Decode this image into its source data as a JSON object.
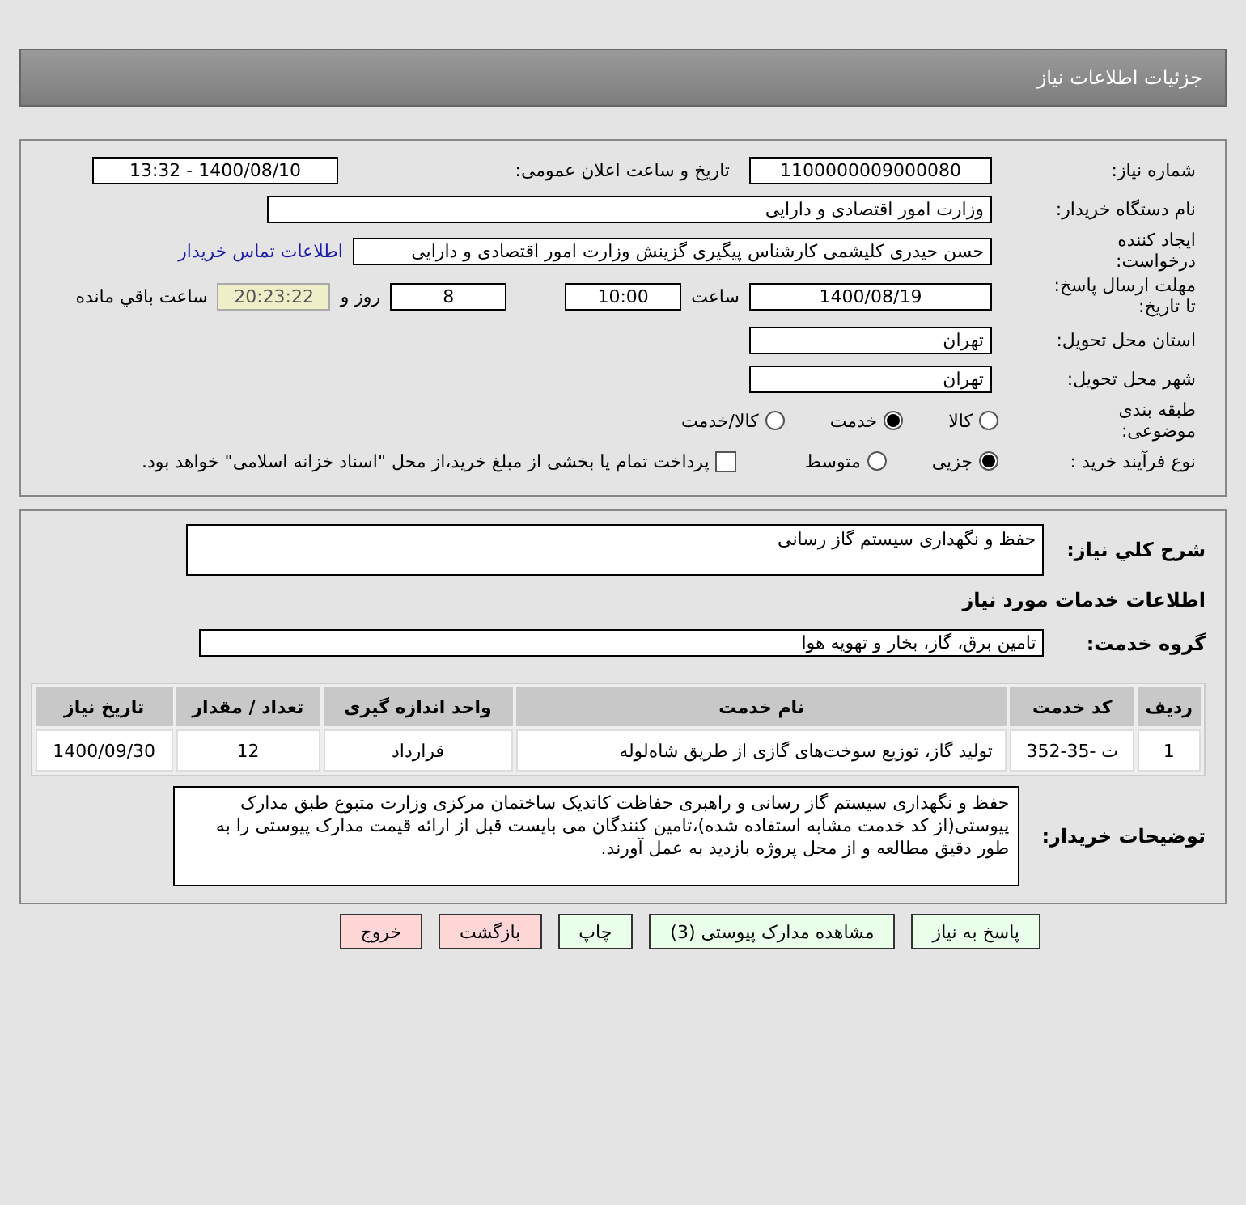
{
  "header": {
    "title": "جزئیات اطلاعات نیاز"
  },
  "details": {
    "need_number": {
      "label": "شماره نیاز:",
      "value": "1100000009000080"
    },
    "announce": {
      "label": "تاریخ و ساعت اعلان عمومی:",
      "value": "1400/08/10 - 13:32"
    },
    "buyer": {
      "label": "نام دستگاه خریدار:",
      "value": "وزارت امور اقتصادی و دارایی"
    },
    "creator": {
      "label": "ایجاد کننده درخواست:",
      "value": "حسن حیدری کلیشمی کارشناس پیگیری گزینش وزارت امور اقتصادی و دارایی",
      "link": "اطلاعات تماس خریدار"
    },
    "deadline": {
      "label": "مهلت ارسال پاسخ: تا تاریخ:",
      "date": "1400/08/19",
      "time_label": "ساعت",
      "time": "10:00",
      "days": "8",
      "days_label": "روز و",
      "remaining": "20:23:22",
      "remaining_label": "ساعت باقي مانده"
    },
    "province": {
      "label": "استان محل تحویل:",
      "value": "تهران"
    },
    "city": {
      "label": "شهر محل تحویل:",
      "value": "تهران"
    },
    "category": {
      "label": "طبقه بندی موضوعی:",
      "options": [
        {
          "label": "کالا",
          "selected": false
        },
        {
          "label": "خدمت",
          "selected": true
        },
        {
          "label": "کالا/خدمت",
          "selected": false
        }
      ]
    },
    "process": {
      "label": "نوع فرآیند خرید :",
      "options": [
        {
          "label": "جزیی",
          "selected": true
        },
        {
          "label": "متوسط",
          "selected": false
        }
      ],
      "treasury": {
        "label": "پرداخت تمام یا بخشی از مبلغ خرید،از محل \"اسناد خزانه اسلامی\" خواهد بود.",
        "checked": false
      }
    }
  },
  "services": {
    "summary_label": "شرح کلي نياز:",
    "summary": "حفظ و نگهداری سیستم گاز رسانی",
    "section_title": "اطلاعات خدمات مورد نیاز",
    "group_label": "گروه خدمت:",
    "group": "تامین برق، گاز، بخار و تهویه هوا",
    "table": {
      "columns": [
        "ردیف",
        "کد خدمت",
        "نام خدمت",
        "واحد اندازه گیری",
        "تعداد / مقدار",
        "تاریخ نیاز"
      ],
      "rows": [
        [
          "1",
          "ت -35-352",
          "تولید گاز، توزیع سوخت‌های گازی از طریق شاه‌لوله",
          "قرارداد",
          "12",
          "1400/09/30"
        ]
      ]
    },
    "notes_label": "توضیحات خریدار:",
    "notes": "حفظ و نگهداری سیستم گاز رسانی و راهبری حفاظت کاتدیک ساختمان مرکزی وزارت متبوع طبق مدارک پیوستی(از کد خدمت مشابه استفاده شده)،تامین کنندگان می بایست قبل از ارائه قیمت مدارک پیوستی را به طور دقیق مطالعه و از محل پروژه بازدید به عمل آورند."
  },
  "buttons": [
    {
      "label": "پاسخ به نیاز",
      "kind": "normal"
    },
    {
      "label": "مشاهده مدارک پیوستی (3)",
      "kind": "normal"
    },
    {
      "label": "چاپ",
      "kind": "normal"
    },
    {
      "label": "بازگشت",
      "kind": "exit"
    },
    {
      "label": "خروج",
      "kind": "exit"
    }
  ]
}
